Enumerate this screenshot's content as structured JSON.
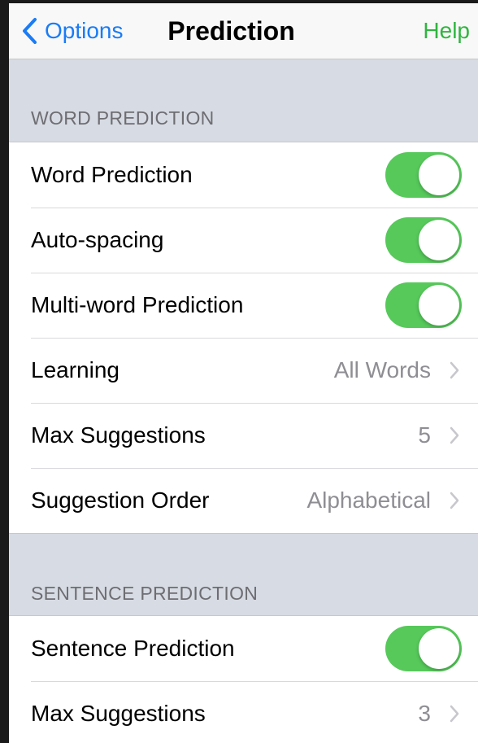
{
  "navbar": {
    "back_label": "Options",
    "title": "Prediction",
    "help_label": "Help"
  },
  "sections": {
    "word": {
      "header": "WORD PREDICTION",
      "word_prediction": {
        "label": "Word Prediction",
        "on": true
      },
      "auto_spacing": {
        "label": "Auto-spacing",
        "on": true
      },
      "multi_word": {
        "label": "Multi-word Prediction",
        "on": true
      },
      "learning": {
        "label": "Learning",
        "value": "All Words"
      },
      "max_suggestions": {
        "label": "Max Suggestions",
        "value": "5"
      },
      "suggestion_order": {
        "label": "Suggestion Order",
        "value": "Alphabetical"
      }
    },
    "sentence": {
      "header": "SENTENCE PREDICTION",
      "sentence_prediction": {
        "label": "Sentence Prediction",
        "on": true
      },
      "max_suggestions": {
        "label": "Max Suggestions",
        "value": "3"
      }
    }
  },
  "icons": {
    "back": "chevron-left-icon",
    "disclosure": "chevron-right-icon"
  },
  "colors": {
    "accent_blue": "#1a7cf5",
    "help_green": "#2fb53f",
    "toggle_on": "#56c95a",
    "grouped_background": "#d7dbe3"
  }
}
